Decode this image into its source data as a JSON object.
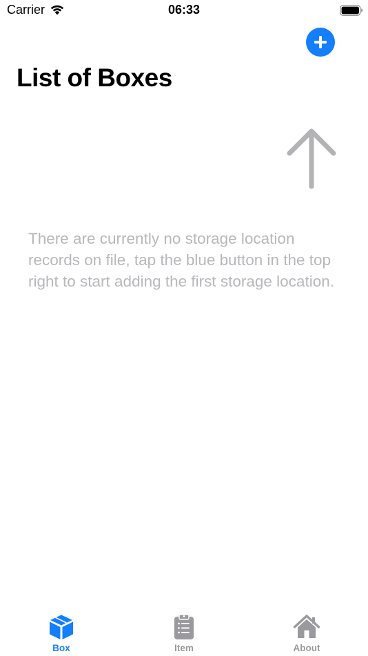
{
  "status_bar": {
    "carrier": "Carrier",
    "time": "06:33"
  },
  "header": {
    "title": "List of Boxes",
    "add_button_icon": "plus-icon"
  },
  "empty_state": {
    "message": "There are currently no storage location records on file, tap the blue button in the top right to start adding the first storage location.",
    "hint_icon": "arrow-up-icon"
  },
  "tab_bar": {
    "active": "Box",
    "tabs": [
      {
        "label": "Box",
        "icon": "cube-icon"
      },
      {
        "label": "Item",
        "icon": "clipboard-list-icon"
      },
      {
        "label": "About",
        "icon": "house-icon"
      }
    ]
  },
  "colors": {
    "accent": "#147EFB",
    "muted_text": "#B8B8BC",
    "inactive_tab": "#9A9A9E"
  }
}
